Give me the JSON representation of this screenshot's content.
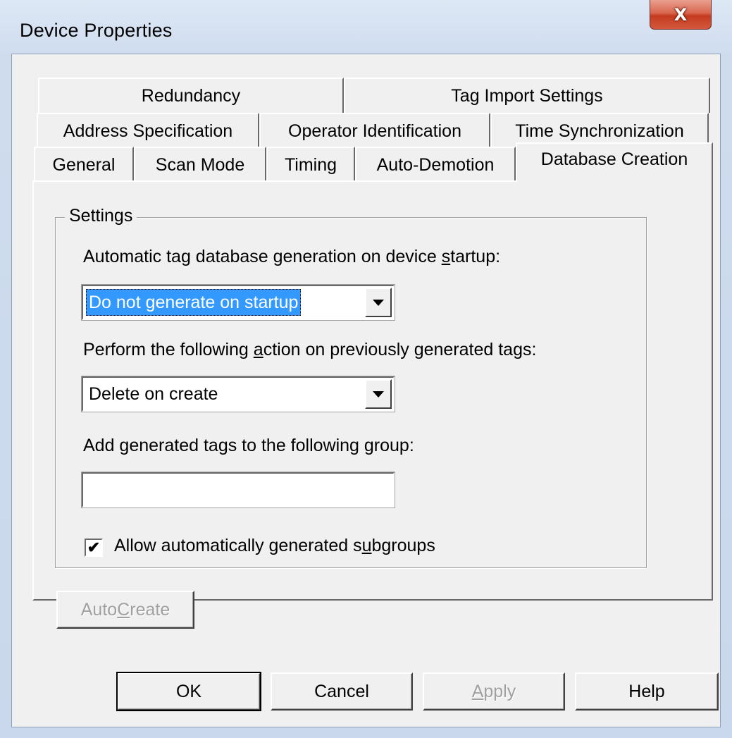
{
  "window": {
    "title": "Device Properties",
    "close_glyph": "X"
  },
  "tabs": {
    "row1": [
      "Redundancy",
      "Tag Import Settings"
    ],
    "row2": [
      "Address Specification",
      "Operator Identification",
      "Time Synchronization"
    ],
    "row3": [
      "General",
      "Scan Mode",
      "Timing",
      "Auto-Demotion",
      "Database Creation"
    ],
    "active": "Database Creation"
  },
  "settings": {
    "legend": "Settings",
    "startup_label_pre": "Automatic tag database generation on device ",
    "startup_label_accel": "s",
    "startup_label_post": "tartup:",
    "startup_value": "Do not generate on startup",
    "action_label_pre": "Perform the following ",
    "action_label_accel": "a",
    "action_label_post": "ction on previously generated tags:",
    "action_value": "Delete on create",
    "group_label_pre": "Add generated tags to the following ",
    "group_label_accel": "g",
    "group_label_post": "roup:",
    "group_value": "",
    "subgroups_label_pre": "Allow automatically generated s",
    "subgroups_label_accel": "u",
    "subgroups_label_post": "bgroups",
    "subgroups_checked": true
  },
  "auto_create": {
    "pre": "Auto ",
    "accel": "C",
    "post": "reate",
    "enabled": false
  },
  "footer": {
    "ok": "OK",
    "cancel": "Cancel",
    "apply_accel": "A",
    "apply_post": "pply",
    "help": "Help"
  },
  "colors": {
    "selection": "#3399ff",
    "dialog_bg": "#f0f0f0",
    "close_button": "#c43b20"
  }
}
